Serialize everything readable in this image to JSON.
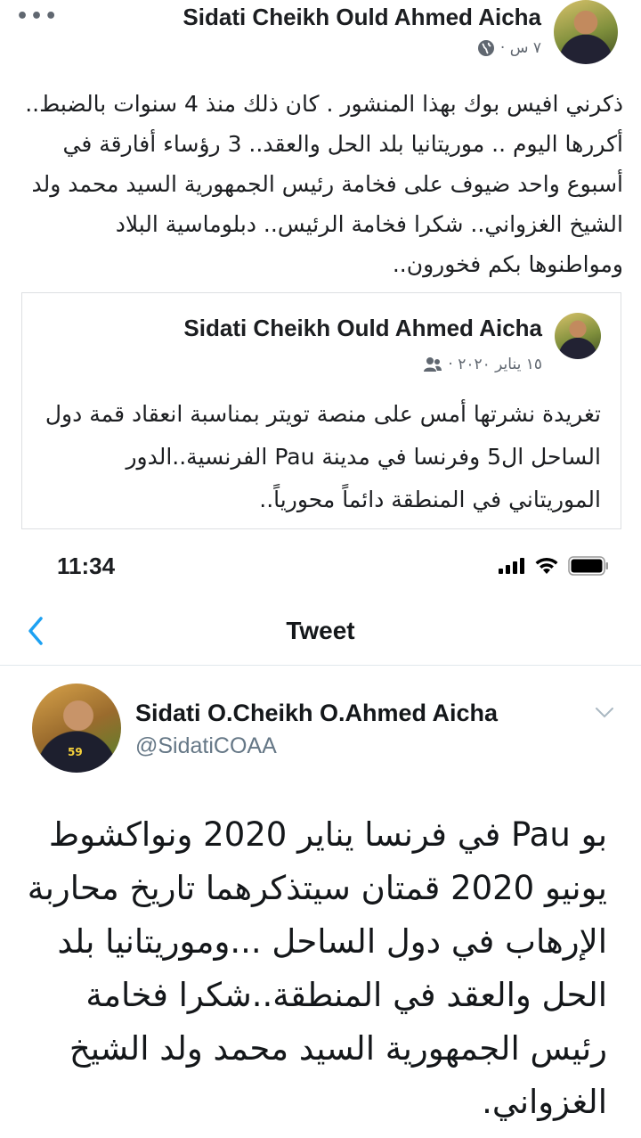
{
  "facebook_post": {
    "more_icon": "more-dots-icon",
    "author": "Sidati Cheikh Ould Ahmed Aicha",
    "time": "٧ س ·",
    "privacy_icon": "globe-icon",
    "text": "ذكرني افيس بوك بهذا المنشور . كان ذلك منذ 4 سنوات بالضبط.. أكررها اليوم .. موريتانيا بلد الحل والعقد.. 3 رؤساء أفارقة في أسبوع واحد ضيوف على فخامة رئيس الجمهورية السيد محمد ولد الشيخ الغزواني.. شكرا فخامة الرئيس.. دبلوماسية البلاد ومواطنوها بكم فخورون..",
    "shared": {
      "author": "Sidati Cheikh Ould Ahmed Aicha",
      "date": "١٥ يناير ٢٠٢٠ ·",
      "privacy_icon": "friends-icon",
      "text": "تغريدة نشرتها أمس على منصة تويتر بمناسبة انعقاد قمة دول الساحل ال5 وفرنسا في مدينة Pau الفرنسية..الدور الموريتاني في المنطقة دائماً محورياً.."
    }
  },
  "status_bar": {
    "time": "11:34",
    "icons": [
      "cellular-signal-icon",
      "wifi-icon",
      "battery-icon"
    ]
  },
  "twitter": {
    "nav": {
      "back_icon": "chevron-left-icon",
      "title": "Tweet"
    },
    "tweet": {
      "display_name": "Sidati O.Cheikh O.Ahmed Aicha",
      "handle": "@SidatiCOAA",
      "avatar_badge": "59",
      "menu_icon": "chevron-down-icon",
      "text": "بو Pau في فرنسا يناير 2020 ونواكشوط يونيو 2020 قمتان سيتذكرهما تاريخ محاربة الإرهاب في دول الساحل ...وموريتانيا بلد الحل والعقد في المنطقة..شكرا فخامة رئيس الجمهورية السيد محمد ولد الشيخ الغزواني."
    }
  },
  "colors": {
    "fb_text": "#1c1e21",
    "fb_meta": "#606770",
    "tw_link": "#1da1f2",
    "tw_handle": "#657786"
  }
}
